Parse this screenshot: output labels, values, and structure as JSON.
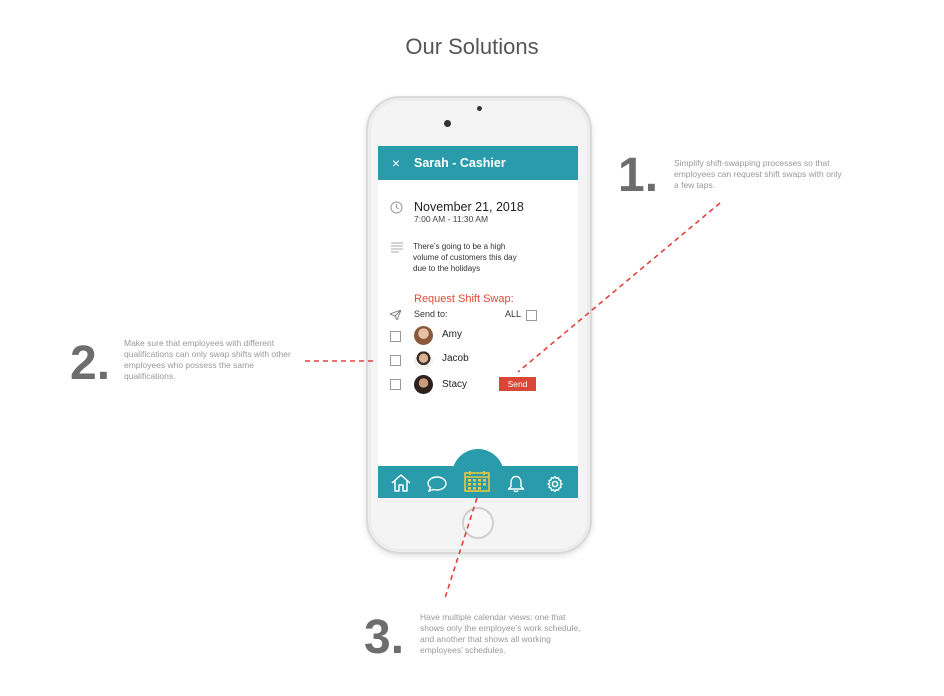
{
  "page": {
    "title": "Our Solutions"
  },
  "notes": [
    {
      "number": "1.",
      "text": "Simplify shift-swapping processes so that employees can request shift swaps with only a few taps."
    },
    {
      "number": "2.",
      "text": "Make sure that employees with different qualifications can only swap shifts with other employees who possess the same qualifications."
    },
    {
      "number": "3.",
      "text": "Have multiple calendar views: one that shows only the employee’s work schedule, and another that shows all working employees’ schedules."
    }
  ],
  "app": {
    "close_icon": "×",
    "title": "Sarah - Cashier",
    "date": "November 21, 2018",
    "time": "7:00 AM - 11:30 AM",
    "description": "There’s going to be a high volume of customers this day due to the holidays",
    "request_title": "Request Shift Swap:",
    "send_to_label": "Send to:",
    "all_label": "ALL",
    "employees": [
      {
        "name": "Amy"
      },
      {
        "name": "Jacob"
      },
      {
        "name": "Stacy"
      }
    ],
    "send_label": "Send",
    "tabs": [
      "home-icon",
      "chat-icon",
      "calendar-icon",
      "bell-icon",
      "settings-icon"
    ]
  },
  "colors": {
    "accent": "#2a9bab",
    "action_red": "#d94637",
    "calendar_icon": "#e8c840"
  }
}
